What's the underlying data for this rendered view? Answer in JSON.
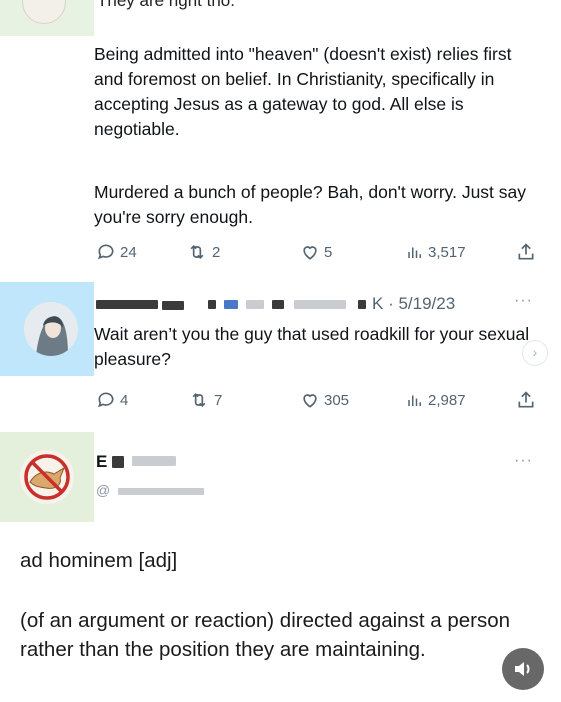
{
  "tweet1": {
    "partial_top_text": "They are right tho.",
    "body_p1": "Being admitted into \"heaven\" (doesn't exist) relies first and foremost on belief. In Christianity, specifically in accepting Jesus as a gateway to god. All else is negotiable.",
    "body_p2": "Murdered a bunch of people? Bah, don't worry. Just say you're sorry enough.",
    "replies": "24",
    "reposts": "2",
    "likes": "5",
    "views": "3,517"
  },
  "tweet2": {
    "handle_suffix": "K",
    "date": "· 5/19/23",
    "more": "···",
    "body": "Wait aren’t you the guy that used roadkill for your sexual pleasure?",
    "replies": "4",
    "reposts": "7",
    "likes": "305",
    "views": "2,987"
  },
  "tweet3": {
    "name_initial": "E",
    "more": "···"
  },
  "definition": {
    "term": "ad hominem [adj]",
    "meaning": "(of an argument or reaction) directed against a person rather than the position they are maintaining."
  },
  "icons": {
    "reply": "reply-icon",
    "repost": "repost-icon",
    "like": "heart-icon",
    "views": "views-icon",
    "share": "share-icon",
    "sound": "speaker-icon",
    "chevron": "chevron-right-icon"
  },
  "colors": {
    "text": "#0f1419",
    "muted": "#536471",
    "avatar2_bg": "#bfe6fb",
    "avatar3_bg": "#e4efdc"
  }
}
